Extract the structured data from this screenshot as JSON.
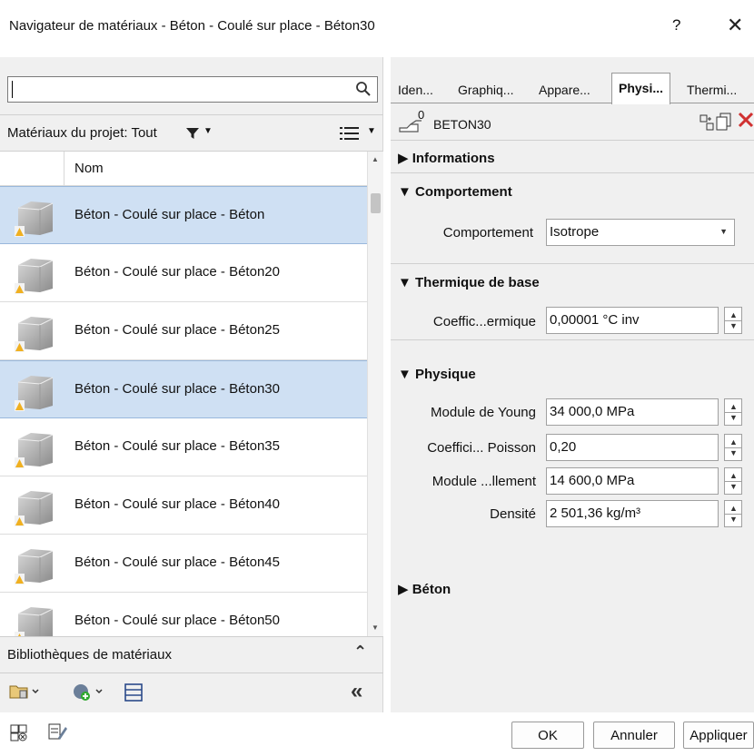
{
  "window": {
    "title": "Navigateur de matériaux - Béton - Coulé sur place - Béton30",
    "help": "?",
    "close": "✕"
  },
  "left": {
    "search": {
      "value": "",
      "icon": "search-icon"
    },
    "filter_label": "Matériaux du projet: Tout",
    "table": {
      "column": "Nom",
      "rows": [
        {
          "name": "Béton - Coulé sur place - Béton",
          "selected": true
        },
        {
          "name": "Béton - Coulé sur place - Béton20",
          "selected": false
        },
        {
          "name": "Béton - Coulé sur place - Béton25",
          "selected": false
        },
        {
          "name": "Béton - Coulé sur place - Béton30",
          "selected": true
        },
        {
          "name": "Béton - Coulé sur place - Béton35",
          "selected": false
        },
        {
          "name": "Béton - Coulé sur place - Béton40",
          "selected": false
        },
        {
          "name": "Béton - Coulé sur place - Béton45",
          "selected": false
        },
        {
          "name": "Béton - Coulé sur place - Béton50",
          "selected": false
        }
      ]
    },
    "libraries_label": "Bibliothèques de matériaux"
  },
  "right": {
    "tabs": [
      "Iden...",
      "Graphiq...",
      "Appare...",
      "Physi...",
      "Thermi..."
    ],
    "active_tab": "Physi...",
    "asset": {
      "count": "0",
      "name": "BETON30"
    },
    "sections": {
      "informations": "Informations",
      "comportement": "Comportement",
      "thermique": "Thermique de base",
      "physique": "Physique",
      "beton": "Béton"
    },
    "props": {
      "comportement_label": "Comportement",
      "comportement_value": "Isotrope",
      "thermal_label": "Coeffic...ermique",
      "thermal_value": "0,00001 °C inv",
      "young_label": "Module de Young",
      "young_value": "34 000,0 MPa",
      "poisson_label": "Coeffici... Poisson",
      "poisson_value": "0,20",
      "shear_label": "Module ...llement",
      "shear_value": "14 600,0 MPa",
      "density_label": "Densité",
      "density_value": "2 501,36 kg/m³"
    }
  },
  "footer": {
    "ok": "OK",
    "cancel": "Annuler",
    "apply": "Appliquer"
  },
  "colors": {
    "selection": "#cfe0f3",
    "panel": "#f0f0f0",
    "warning": "#f0b020",
    "delete": "#d03030"
  }
}
